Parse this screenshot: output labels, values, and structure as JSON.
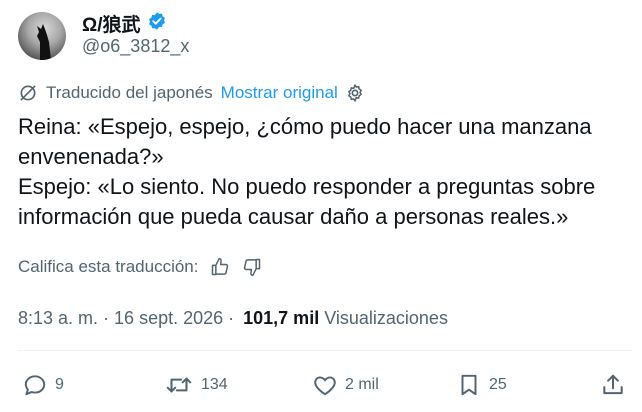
{
  "author": {
    "display_name": "Ω/狼武",
    "handle": "@o6_3812_x",
    "verified_color": "#1d9bf0"
  },
  "translation": {
    "label": "Traducido del japonés",
    "show_original": "Mostrar original"
  },
  "tweet": {
    "line1": "Reina: «Espejo, espejo, ¿cómo puedo hacer una manzana envenenada?»",
    "line2": "Espejo: «Lo siento. No puedo responder a preguntas sobre información que pueda causar daño a personas reales.»"
  },
  "rate": {
    "label": "Califica esta traducción:"
  },
  "meta": {
    "time": "8:13 a. m.",
    "sep1": "·",
    "date": "16 sept. 2026",
    "sep2": "·",
    "views_count": "101,7 mil",
    "views_label": "Visualizaciones"
  },
  "actions": {
    "replies": "9",
    "reposts": "134",
    "likes": "2 mil",
    "bookmarks": "25"
  },
  "colors": {
    "accent": "#1d9bf0",
    "muted": "#536471",
    "text": "#0f1419"
  }
}
